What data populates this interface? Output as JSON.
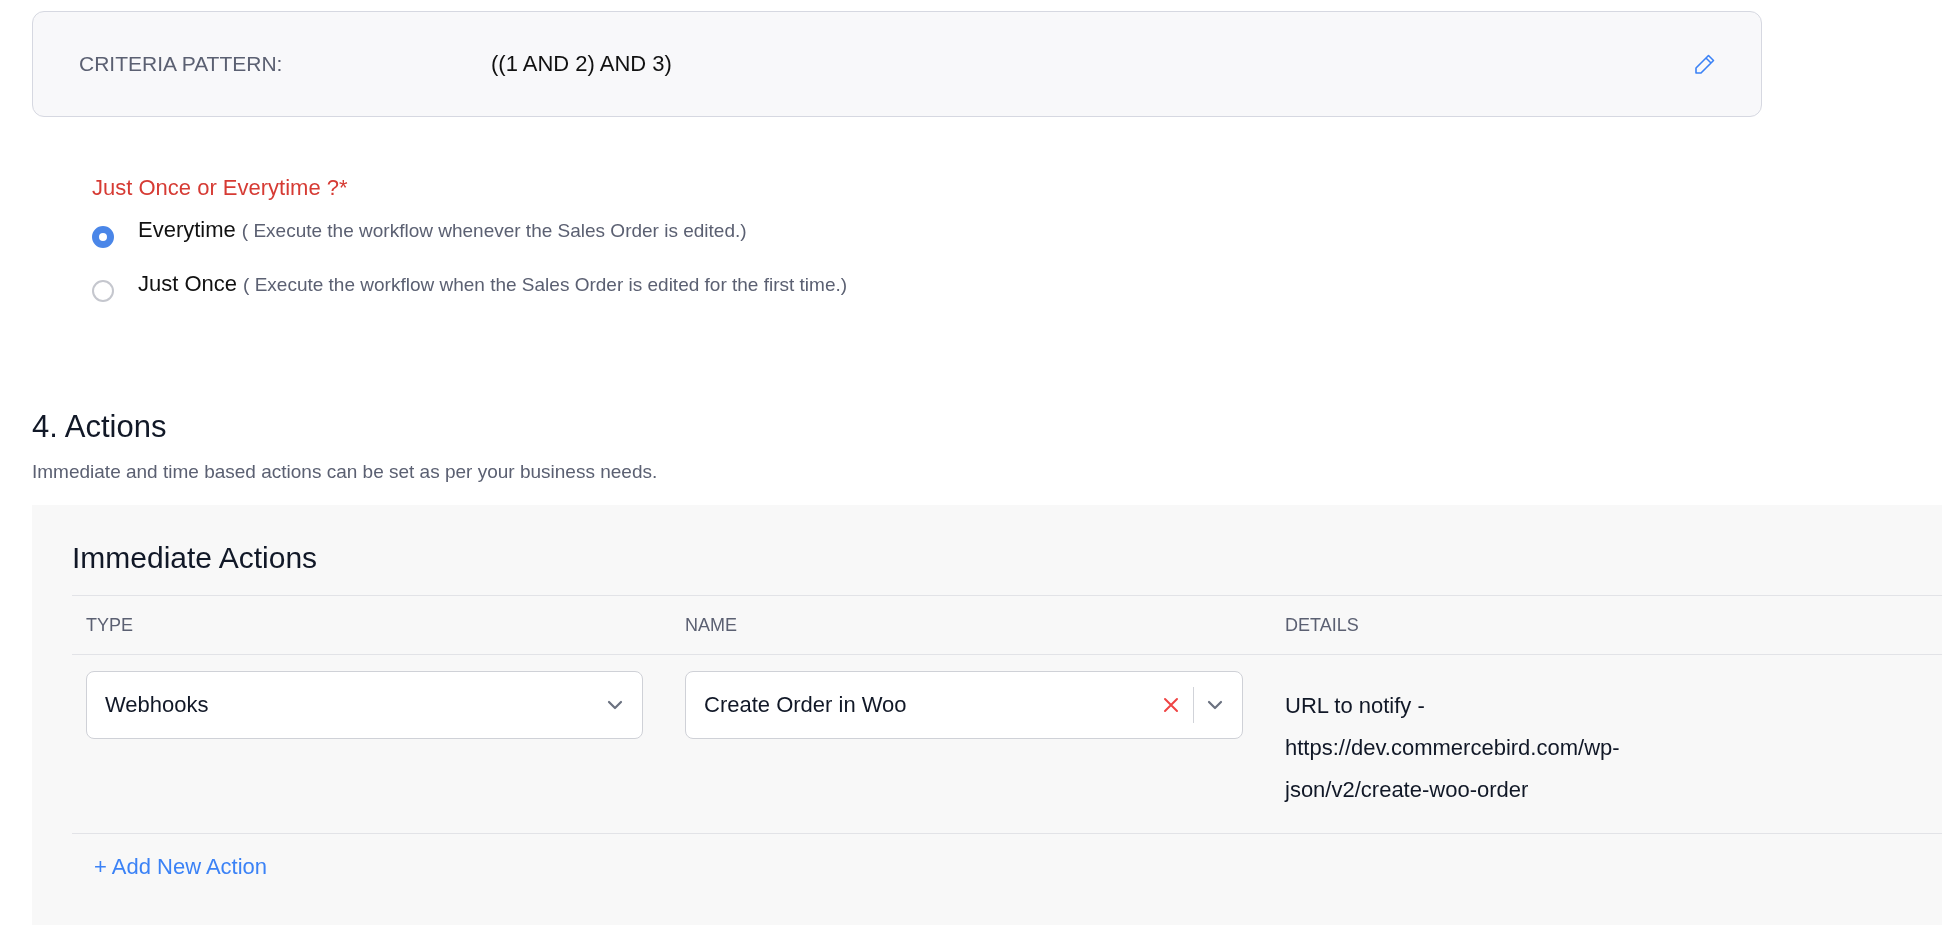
{
  "criteria": {
    "label": "CRITERIA PATTERN:",
    "value": "((1 AND 2) AND 3)"
  },
  "execution": {
    "title": "Just Once or Everytime ?*",
    "options": [
      {
        "label": "Everytime",
        "description": "( Execute the workflow whenever the Sales Order is edited.)",
        "selected": true
      },
      {
        "label": "Just Once",
        "description": "( Execute the workflow when the Sales Order is edited for the first time.)",
        "selected": false
      }
    ]
  },
  "actions": {
    "heading": "4. Actions",
    "subtitle": "Immediate and time based actions can be set as per your business needs.",
    "immediate": {
      "title": "Immediate Actions",
      "columns": [
        "TYPE",
        "NAME",
        "DETAILS"
      ],
      "rows": [
        {
          "type": "Webhooks",
          "name": "Create Order in Woo",
          "details": [
            "URL to notify -",
            "https://dev.commercebird.com/wp-",
            "json/v2/create-woo-order"
          ]
        }
      ]
    },
    "add_link": "+ Add New Action"
  }
}
